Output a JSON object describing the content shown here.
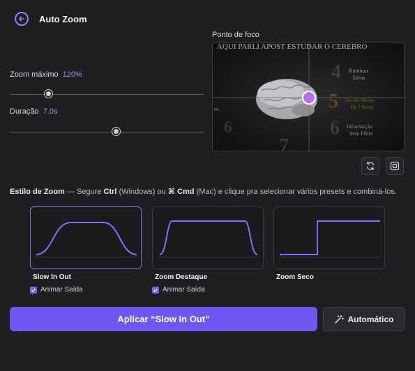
{
  "header": {
    "title": "Auto Zoom",
    "back_icon": "arrow-left-circle-icon"
  },
  "zoom": {
    "label": "Zoom máximo",
    "value": "120%",
    "level": 0.2
  },
  "duration": {
    "label": "Duração",
    "value": "7.0s",
    "level": 0.55
  },
  "focus": {
    "label": "Ponto de foco",
    "image_text": {
      "top_line": "AQUI PARLI APOST ESTUDAR O CEREBRO",
      "item4_line1": "Ruminar",
      "item4_line2": "Erros",
      "item5_line1": "Decidir Menos",
      "item5_line2": "De 7 Horas",
      "item6_line1": "Informação",
      "item6_line2": "Sem Filtro",
      "left_fragment": "ns",
      "num4": "4",
      "num5": "5",
      "num6": "6",
      "num7": "7"
    },
    "reset_icon": "refresh-icon",
    "frame_icon": "frame-icon"
  },
  "style_section": {
    "heading_bold": "Estilo de Zoom",
    "heading_dash": " — Segure ",
    "key_ctrl": "Ctrl",
    "os_windows": " (Windows) ou ",
    "key_cmd": "⌘ Cmd",
    "rest": " (Mac) e clique pra selecionar vários presets e combiná-los."
  },
  "presets": [
    {
      "name": "Slow In Out",
      "selected": true,
      "checkbox_label": "Animar Saída",
      "checked": true
    },
    {
      "name": "Zoom Destaque",
      "selected": false,
      "checkbox_label": "Animar Saída",
      "checked": true
    },
    {
      "name": "Zoom Seco",
      "selected": false
    }
  ],
  "actions": {
    "apply_label": "Aplicar “Slow In Out”",
    "auto_label": "Automático",
    "auto_icon": "magic-wand-icon"
  },
  "colors": {
    "accent": "#7c5cf4",
    "curve": "#8a6cf2",
    "focus_dot": "#b870f0",
    "background": "#1f1f21"
  }
}
